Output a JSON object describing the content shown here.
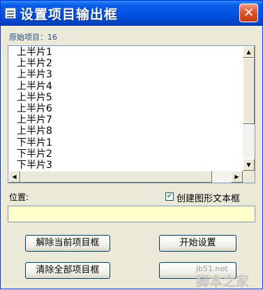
{
  "window": {
    "title": "设置项目输出框",
    "close_symbol": "✕"
  },
  "source_count_label": "原始项目：16",
  "list": {
    "items": [
      "上半片1",
      "上半片2",
      "上半片3",
      "上半片4",
      "上半片5",
      "上半片6",
      "上半片7",
      "上半片8",
      "下半片1",
      "下半片2",
      "下半片3"
    ]
  },
  "position": {
    "label": "位置:",
    "value": ""
  },
  "create_text_box": {
    "label": "创建图形文本框",
    "checked": true
  },
  "buttons": {
    "remove_current": "解除当前项目框",
    "start_setup": "开始设置",
    "clear_all": "清除全部项目框"
  },
  "watermark": {
    "site": "jb51.net",
    "name": "脚本之家"
  },
  "colors": {
    "title_bar": "#0354E8",
    "close_button": "#E2552B",
    "position_field": "#FFFFCC"
  }
}
